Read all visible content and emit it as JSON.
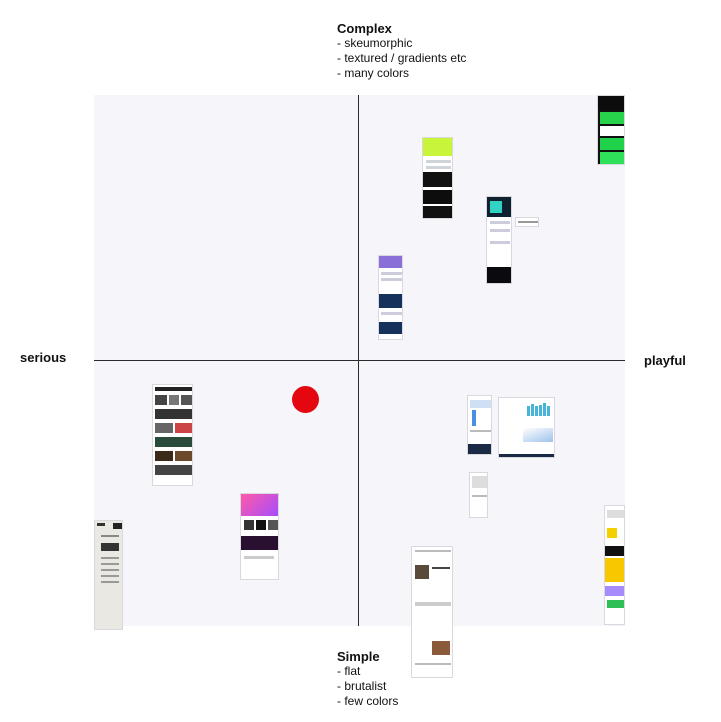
{
  "top": {
    "title": "Complex",
    "items": [
      "- skeumorphic",
      "- textured / gradients etc",
      "- many colors"
    ]
  },
  "bottom": {
    "title": "Simple",
    "items": [
      "- flat",
      "- brutalist",
      "- few colors"
    ]
  },
  "left_label": "serious",
  "right_label": "playful",
  "colors": {
    "plot_bg": "#f6f5fa",
    "axis": "#2b2b2b",
    "marker": "#e4070f"
  },
  "thumbnails": [
    {
      "name": "thumb-green-black-top-right",
      "theme": "green-black"
    },
    {
      "name": "thumb-lime-dark",
      "theme": "lime-dark"
    },
    {
      "name": "thumb-teal-dark",
      "theme": "teal-dark"
    },
    {
      "name": "thumb-small-wide",
      "theme": "light"
    },
    {
      "name": "thumb-purple-navy",
      "theme": "purple-navy"
    },
    {
      "name": "thumb-newspaper",
      "theme": "news"
    },
    {
      "name": "thumb-pink-gradient",
      "theme": "pink-gradient"
    },
    {
      "name": "thumb-beige-text",
      "theme": "beige"
    },
    {
      "name": "thumb-blue-dashboard",
      "theme": "blue-light"
    },
    {
      "name": "thumb-chart-dashboard",
      "theme": "chart"
    },
    {
      "name": "thumb-small-grey",
      "theme": "grey"
    },
    {
      "name": "thumb-minimal-cards",
      "theme": "light-photo"
    },
    {
      "name": "thumb-yellow-purple",
      "theme": "yellow-purple"
    }
  ]
}
